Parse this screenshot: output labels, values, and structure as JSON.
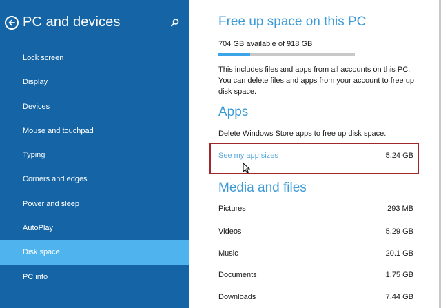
{
  "sidebar": {
    "title": "PC and devices",
    "back_icon": "back-arrow-circle-icon",
    "search_icon": "search-icon",
    "items": [
      {
        "label": "Lock screen"
      },
      {
        "label": "Display"
      },
      {
        "label": "Devices"
      },
      {
        "label": "Mouse and touchpad"
      },
      {
        "label": "Typing"
      },
      {
        "label": "Corners and edges"
      },
      {
        "label": "Power and sleep"
      },
      {
        "label": "AutoPlay"
      },
      {
        "label": "Disk space",
        "selected": true
      },
      {
        "label": "PC info"
      }
    ],
    "colors": {
      "background": "#1565a6",
      "selected": "#4fb3ee"
    }
  },
  "main": {
    "free_space": {
      "heading": "Free up space on this PC",
      "available_text": "704 GB available of 918 GB",
      "used_fraction": 0.233,
      "description": "This includes files and apps from all accounts on this PC. You can delete files and apps from your account to free up disk space."
    },
    "apps": {
      "heading": "Apps",
      "description": "Delete Windows Store apps to free up disk space.",
      "link_label": "See my app sizes",
      "app_size": "5.24 GB"
    },
    "media": {
      "heading": "Media and files",
      "rows": [
        {
          "name": "Pictures",
          "size": "293 MB"
        },
        {
          "name": "Videos",
          "size": "5.29 GB"
        },
        {
          "name": "Music",
          "size": "20.1 GB"
        },
        {
          "name": "Documents",
          "size": "1.75 GB"
        },
        {
          "name": "Downloads",
          "size": "7.44 GB"
        }
      ]
    },
    "colors": {
      "heading": "#3b9ad8",
      "link": "#5aa9df",
      "highlight_box": "#a1272b",
      "progress_fill": "#3ba5e8"
    }
  }
}
